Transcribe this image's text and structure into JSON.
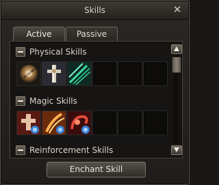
{
  "window": {
    "title": "Skills",
    "close_glyph": "✕"
  },
  "tabs": [
    {
      "label": "Active",
      "selected": true
    },
    {
      "label": "Passive",
      "selected": false
    }
  ],
  "sections": [
    {
      "label": "Physical Skills",
      "slots": [
        "bronze-orb-skill-icon",
        "holy-cross-skill-icon",
        "green-claw-skill-icon",
        "empty",
        "empty",
        "empty"
      ]
    },
    {
      "label": "Magic Skills",
      "slots": [
        "red-cross-skill-icon",
        "fire-hand-skill-icon",
        "red-swirl-skill-icon",
        "empty",
        "empty",
        "empty"
      ]
    },
    {
      "label": "Reinforcement Skills",
      "slots": []
    }
  ],
  "footer": {
    "enchant_label": "Enchant Skill"
  }
}
